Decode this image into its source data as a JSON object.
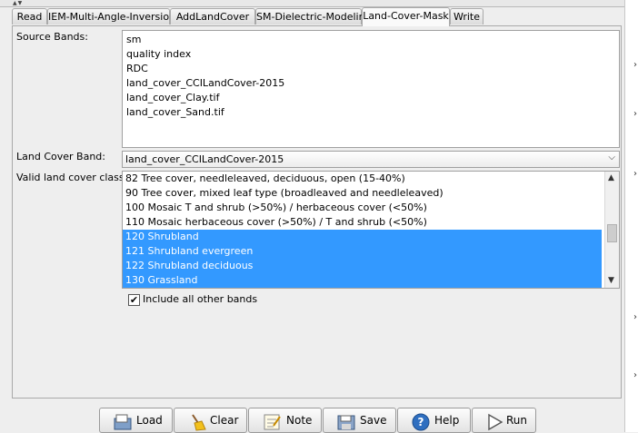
{
  "tabs": [
    {
      "label": "Read"
    },
    {
      "label": "IEM-Multi-Angle-Inversion"
    },
    {
      "label": "AddLandCover"
    },
    {
      "label": "SM-Dielectric-Modeling"
    },
    {
      "label": "Land-Cover-Mask"
    },
    {
      "label": "Write"
    }
  ],
  "active_tab": "Land-Cover-Mask",
  "source_bands": {
    "label": "Source Bands:",
    "items": [
      "sm",
      "quality index",
      "RDC",
      "land_cover_CCILandCover-2015",
      "land_cover_Clay.tif",
      "land_cover_Sand.tif"
    ]
  },
  "land_cover_band": {
    "label": "Land Cover Band:",
    "value": "land_cover_CCILandCover-2015"
  },
  "valid_classes": {
    "label": "Valid land cover classes:",
    "items": [
      {
        "text": "82 Tree cover, needleleaved, deciduous, open (15-40%)",
        "selected": false
      },
      {
        "text": "90 Tree cover, mixed leaf type (broadleaved and needleleaved)",
        "selected": false
      },
      {
        "text": "100 Mosaic T and shrub (>50%) / herbaceous cover (<50%)",
        "selected": false
      },
      {
        "text": "110 Mosaic herbaceous cover (>50%) / T and shrub (<50%)",
        "selected": false
      },
      {
        "text": "120 Shrubland",
        "selected": true
      },
      {
        "text": "121 Shrubland evergreen",
        "selected": true
      },
      {
        "text": "122 Shrubland deciduous",
        "selected": true
      },
      {
        "text": "130 Grassland",
        "selected": true
      }
    ]
  },
  "include_all": {
    "label": "Include all other bands",
    "checked": true,
    "mark": "✔"
  },
  "buttons": {
    "load": "Load",
    "clear": "Clear",
    "note": "Note",
    "save": "Save",
    "help": "Help",
    "run": "Run"
  },
  "colors": {
    "selection": "#3399ff",
    "help_icon": "#2f6fc0"
  }
}
